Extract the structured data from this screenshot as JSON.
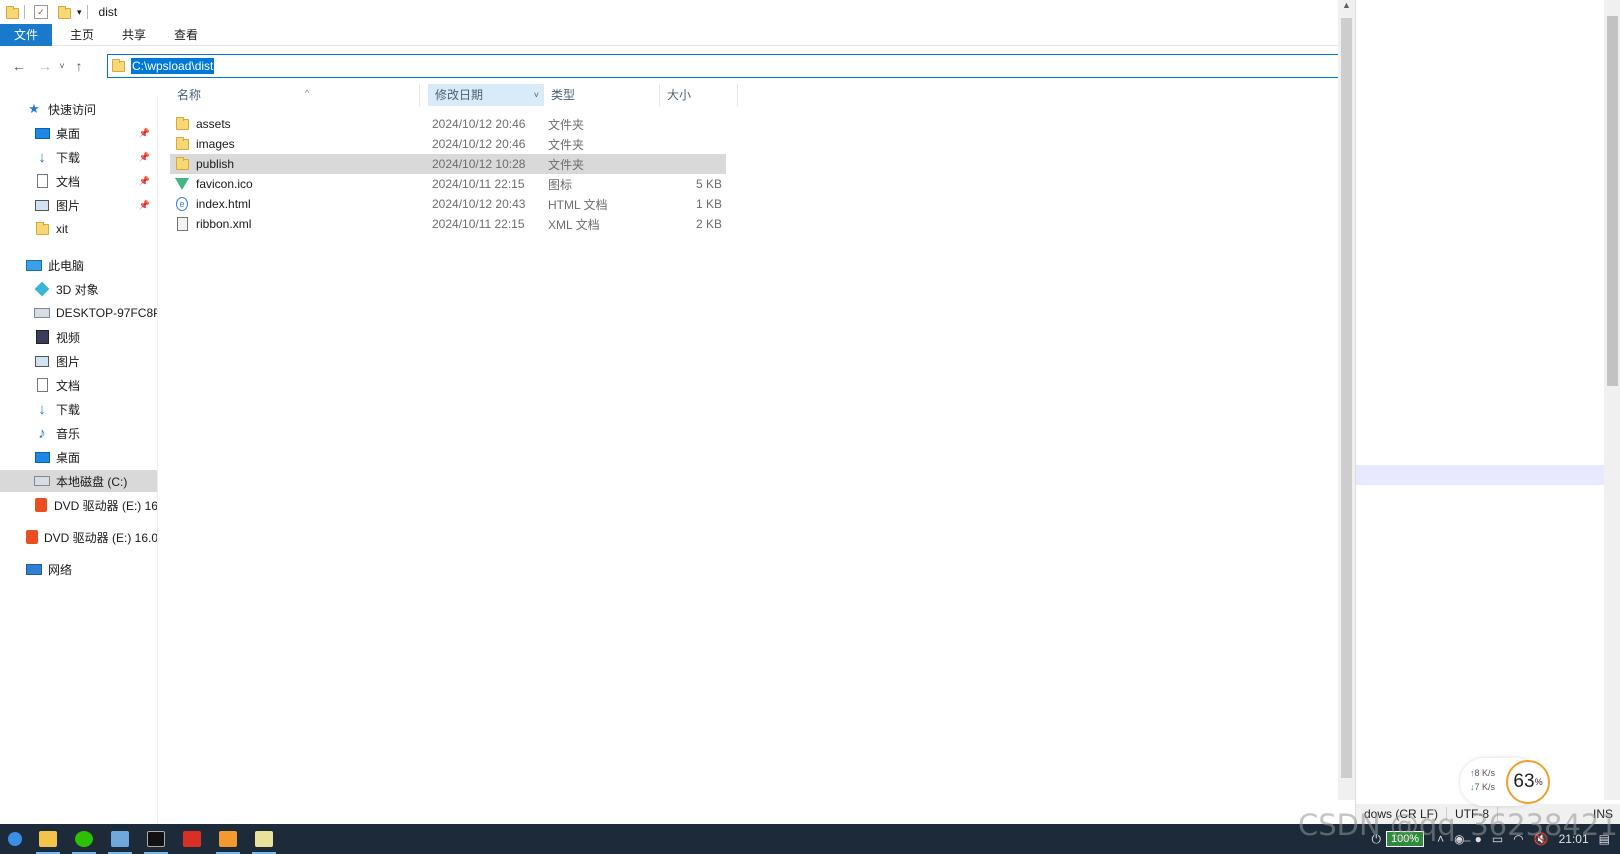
{
  "window": {
    "title": "dist",
    "ribbon_tabs": [
      "文件",
      "主页",
      "共享",
      "查看"
    ],
    "address": "C:\\wpsload\\dist"
  },
  "columns": {
    "name": "名称",
    "date": "修改日期",
    "type": "类型",
    "size": "大小"
  },
  "files": [
    {
      "name": "assets",
      "date": "2024/10/12 20:46",
      "type": "文件夹",
      "size": "",
      "icon": "folder-icon"
    },
    {
      "name": "images",
      "date": "2024/10/12 20:46",
      "type": "文件夹",
      "size": "",
      "icon": "folder-icon"
    },
    {
      "name": "publish",
      "date": "2024/10/12 10:28",
      "type": "文件夹",
      "size": "",
      "icon": "folder-icon"
    },
    {
      "name": "favicon.ico",
      "date": "2024/10/11 22:15",
      "type": "图标",
      "size": "5 KB",
      "icon": "vue-icon"
    },
    {
      "name": "index.html",
      "date": "2024/10/12 20:43",
      "type": "HTML 文档",
      "size": "1 KB",
      "icon": "html-file-icon"
    },
    {
      "name": "ribbon.xml",
      "date": "2024/10/11 22:15",
      "type": "XML 文档",
      "size": "2 KB",
      "icon": "xml-file-icon"
    }
  ],
  "sidebar": {
    "quick_access": "快速访问",
    "quick_items": [
      "桌面",
      "下载",
      "文档",
      "图片",
      "xit"
    ],
    "this_pc": "此电脑",
    "pc_items": [
      "3D 对象",
      "DESKTOP-97FC8P",
      "视频",
      "图片",
      "文档",
      "下载",
      "音乐",
      "桌面",
      "本地磁盘 (C:)",
      "DVD 驱动器 (E:) 16"
    ],
    "dvd": "DVD 驱动器 (E:) 16.0",
    "network": "网络"
  },
  "editor_status": {
    "eol": "dows (CR LF)",
    "encoding": "UTF-8",
    "mode": "INS"
  },
  "net_widget": {
    "up": "8",
    "down": "7",
    "unit": "K/s",
    "percent": "63",
    "percent_sign": "%"
  },
  "taskbar": {
    "battery": "100%",
    "time": "21:01"
  },
  "watermark": "CSDN @qq_36238421"
}
